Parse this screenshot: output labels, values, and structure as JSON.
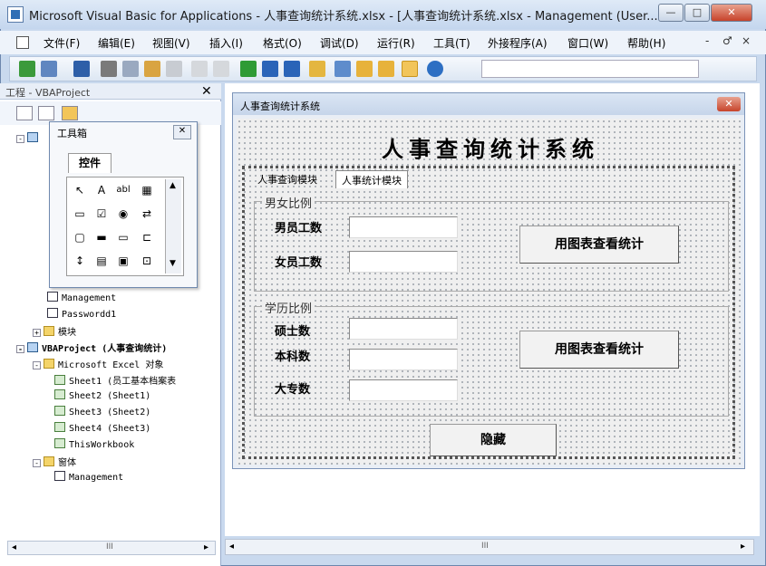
{
  "window": {
    "title": "Microsoft Visual Basic for Applications - 人事查询统计系统.xlsx - [人事查询统计系统.xlsx - Management (User...",
    "min": "—",
    "max": "□",
    "close": "✕"
  },
  "menubar": {
    "items": [
      "文件(F)",
      "编辑(E)",
      "视图(V)",
      "插入(I)",
      "格式(O)",
      "调试(D)",
      "运行(R)",
      "工具(T)",
      "外接程序(A)",
      "窗口(W)",
      "帮助(H)"
    ],
    "mdi_controls": [
      "-",
      "♂",
      "×"
    ]
  },
  "project_explorer": {
    "title": "工程 - VBAProject",
    "close": "✕",
    "tree": [
      {
        "text": "Management",
        "indent": 3,
        "icon": "form"
      },
      {
        "text": "Passwordd1",
        "indent": 3,
        "icon": "form"
      },
      {
        "text": "模块",
        "indent": 2,
        "icon": "folder",
        "expand": "+"
      },
      {
        "text": "VBAProject (人事查询统计)",
        "indent": 0,
        "icon": "proj",
        "expand": "-",
        "bold": true
      },
      {
        "text": "Microsoft Excel 对象",
        "indent": 2,
        "icon": "folder",
        "expand": "-"
      },
      {
        "text": "Sheet1 (员工基本档案表",
        "indent": 3,
        "icon": "sheet"
      },
      {
        "text": "Sheet2 (Sheet1)",
        "indent": 3,
        "icon": "sheet"
      },
      {
        "text": "Sheet3 (Sheet2)",
        "indent": 3,
        "icon": "sheet"
      },
      {
        "text": "Sheet4 (Sheet3)",
        "indent": 3,
        "icon": "sheet"
      },
      {
        "text": "ThisWorkbook",
        "indent": 3,
        "icon": "sheet"
      },
      {
        "text": "窗体",
        "indent": 2,
        "icon": "folder",
        "expand": "-"
      },
      {
        "text": "Management",
        "indent": 3,
        "icon": "form"
      }
    ],
    "scroll_label": "III"
  },
  "toolbox": {
    "title": "工具箱",
    "tab": "控件",
    "tools": [
      "↖",
      "A",
      "abl",
      "▦",
      "▭",
      "☑",
      "◉",
      "⇄",
      "▢",
      "▬",
      "▭",
      "↕",
      "▤",
      "▣",
      "⊡",
      "▥"
    ]
  },
  "userform": {
    "title": "人事查询统计系统",
    "close": "✕",
    "heading": "人事查询统计系统",
    "tabs": [
      "人事查询模块",
      "人事统计模块"
    ],
    "frames": [
      {
        "caption": "男女比例",
        "fields": [
          "男员工数",
          "女员工数"
        ],
        "button": "用图表查看统计"
      },
      {
        "caption": "学历比例",
        "fields": [
          "硕士数",
          "本科数",
          "大专数"
        ],
        "button": "用图表查看统计"
      }
    ],
    "hide_button": "隐藏"
  },
  "code_area": {
    "scroll_label": "III"
  }
}
